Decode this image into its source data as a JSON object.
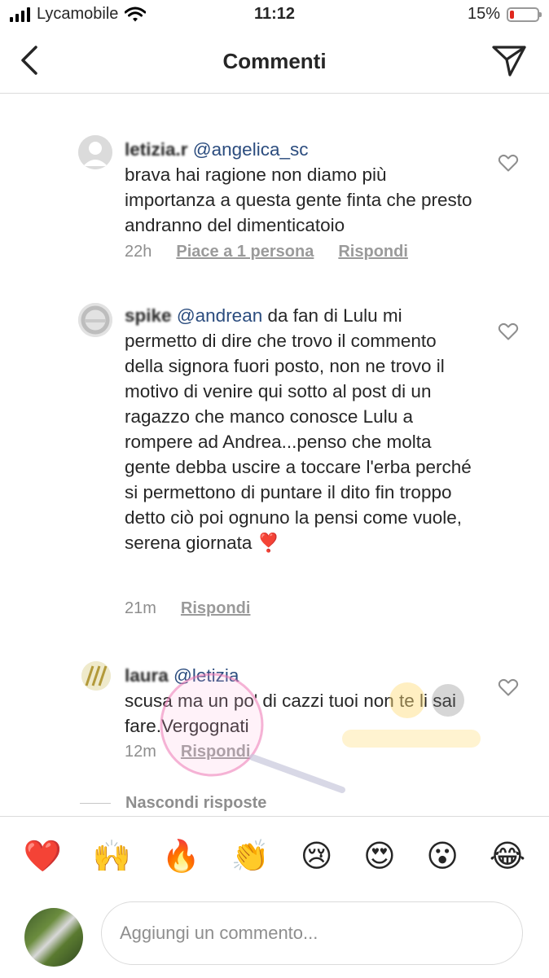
{
  "status_bar": {
    "carrier": "Lycamobile",
    "time": "11:12",
    "battery": "15%",
    "battery_level": 0.15
  },
  "header": {
    "title": "Commenti"
  },
  "comments": [
    {
      "username": "letizia.r",
      "mention": "@angelica_sc",
      "text": "brava hai ragione non diamo più importanza a questa gente finta che presto andranno del dimenticatoio",
      "time": "22h",
      "likes": "Piace a 1 persona",
      "reply": "Rispondi"
    },
    {
      "username": "spike",
      "mention": "@andrean",
      "text_lead": "da",
      "text": "fan di Lulu mi permetto di dire che trovo il commento della signora fuori posto, non ne trovo il motivo di venire qui sotto al post di un ragazzo che manco conosce Lulu  a rompere ad Andrea...penso che molta gente debba uscire a toccare l'erba perché si permettono di puntare il dito fin troppo detto ciò poi ognuno la pensi come vuole, serena giornata ❣️",
      "time": "21m",
      "reply": "Rispondi"
    },
    {
      "username": "laura",
      "mention": "@letizia",
      "text": "scusa ma un po'  di cazzi  tuoi non te li sai fare.Vergognati",
      "time": "12m",
      "reply": "Rispondi"
    }
  ],
  "hide_replies": "Nascondi risposte",
  "emoji_bar": [
    {
      "name": "heart",
      "glyph": "❤️"
    },
    {
      "name": "raised-hands",
      "glyph": "🙌"
    },
    {
      "name": "fire",
      "glyph": "🔥"
    },
    {
      "name": "clapping-hands",
      "glyph": "👏"
    },
    {
      "name": "crying-face",
      "glyph": "😢"
    },
    {
      "name": "heart-eyes",
      "glyph": "😍"
    },
    {
      "name": "surprised-face",
      "glyph": "😮"
    },
    {
      "name": "tears-of-joy",
      "glyph": "😂"
    }
  ],
  "comment_input": {
    "placeholder": "Aggiungi un commento..."
  },
  "colors": {
    "text": "#262626",
    "muted": "#8e8e8e",
    "mention": "#2b4c7e",
    "battery_low": "#e0281e",
    "divider": "#dbdbdb"
  },
  "icons": {
    "back": "chevron-left-icon",
    "send": "paper-plane-icon",
    "like": "heart-outline-icon"
  }
}
